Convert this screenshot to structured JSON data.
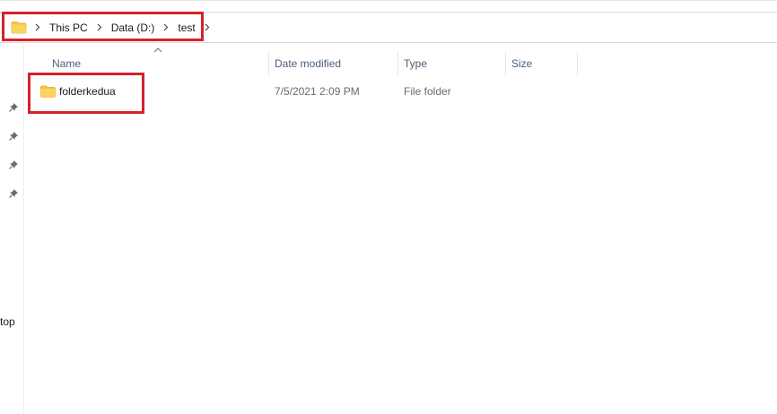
{
  "address": {
    "path": [
      {
        "label": "This PC"
      },
      {
        "label": "Data (D:)"
      },
      {
        "label": "test"
      }
    ]
  },
  "nav": {
    "truncated_label": "top"
  },
  "columns": {
    "name": "Name",
    "date_modified": "Date modified",
    "type": "Type",
    "size": "Size"
  },
  "files": [
    {
      "name": "folderkedua",
      "date_modified": "7/5/2021 2:09 PM",
      "type": "File folder",
      "size": ""
    }
  ],
  "colors": {
    "annotation": "#d6212a",
    "folder": "#f6c342",
    "header_text": "#4c607a"
  }
}
